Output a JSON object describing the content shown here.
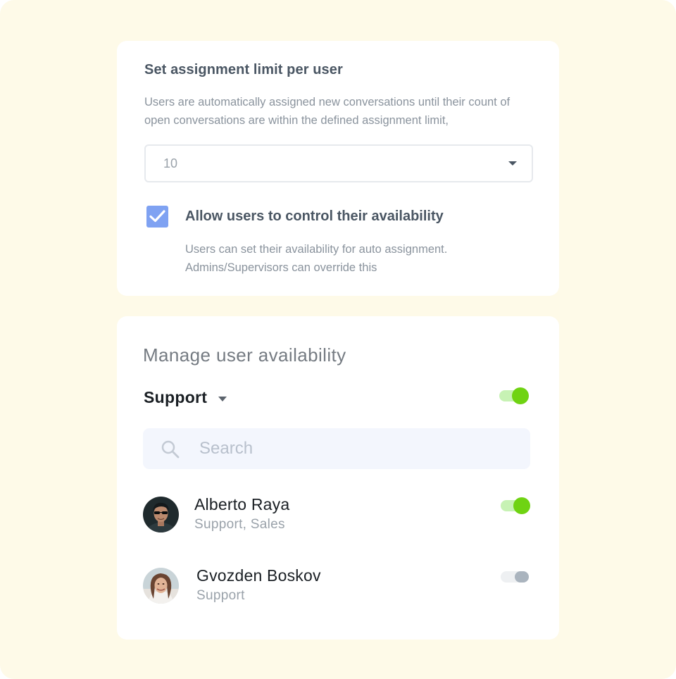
{
  "assignment_limit": {
    "title": "Set assignment limit per user",
    "description": "Users are automatically assigned new conversations until their count of open conversations are within the defined assignment limit,",
    "selected_value": "10",
    "checkbox": {
      "checked": true,
      "label": "Allow users to control their availability",
      "help": "Users can set their availability for auto assignment. Admins/Supervisors can override this"
    }
  },
  "availability": {
    "title": "Manage user availability",
    "team": "Support",
    "team_toggle_on": true,
    "search_placeholder": "Search",
    "users": [
      {
        "name": "Alberto Raya",
        "teams": "Support, Sales",
        "available": true
      },
      {
        "name": "Gvozden Boskov",
        "teams": "Support",
        "available": false
      }
    ]
  },
  "colors": {
    "background": "#fefae8",
    "accent_blue": "#7fa2f2",
    "toggle_on": "#6fd312",
    "toggle_off": "#aab4be"
  },
  "icons": {
    "checkbox": "check-icon",
    "dropdown": "caret-down-icon",
    "search": "search-icon"
  }
}
